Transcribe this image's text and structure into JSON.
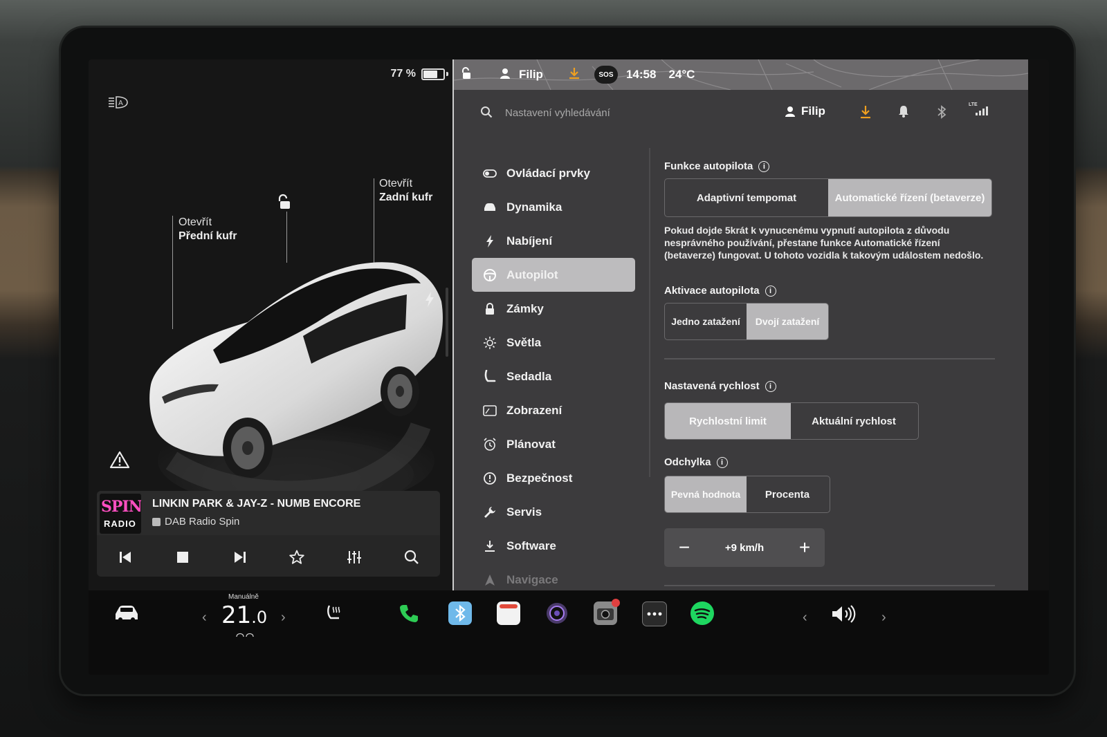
{
  "battery": {
    "percent_label": "77 %",
    "level": 0.77
  },
  "car": {
    "front_trunk": {
      "line1": "Otevřít",
      "line2": "Přední kufr"
    },
    "rear_trunk": {
      "line1": "Otevřít",
      "line2": "Zadní kufr"
    }
  },
  "media": {
    "album_line1": "SPIN",
    "album_line2": "RADIO",
    "song": "LINKIN PARK & JAY-Z - NUMB ENCORE",
    "station": "DAB Radio Spin"
  },
  "statusbar": {
    "user": "Filip",
    "sos": "SOS",
    "time": "14:58",
    "temperature": "24°C"
  },
  "search": {
    "placeholder": "Nastavení vyhledávání"
  },
  "header": {
    "user": "Filip",
    "lte": "LTE"
  },
  "menu": [
    {
      "label": "Ovládací prvky",
      "icon": "toggle-icon"
    },
    {
      "label": "Dynamika",
      "icon": "car-icon"
    },
    {
      "label": "Nabíjení",
      "icon": "bolt-icon"
    },
    {
      "label": "Autopilot",
      "icon": "steering-wheel-icon",
      "active": true
    },
    {
      "label": "Zámky",
      "icon": "lock-icon"
    },
    {
      "label": "Světla",
      "icon": "sun-icon"
    },
    {
      "label": "Sedadla",
      "icon": "seat-icon"
    },
    {
      "label": "Zobrazení",
      "icon": "display-icon"
    },
    {
      "label": "Plánovat",
      "icon": "alarm-clock-icon"
    },
    {
      "label": "Bezpečnost",
      "icon": "alert-circle-icon"
    },
    {
      "label": "Servis",
      "icon": "wrench-icon"
    },
    {
      "label": "Software",
      "icon": "download-icon"
    },
    {
      "label": "Navigace",
      "icon": "navigation-icon"
    }
  ],
  "autopilot": {
    "features": {
      "title": "Funkce autopilota",
      "options": [
        "Adaptivní tempomat",
        "Automatické řízení (betaverze)"
      ],
      "selected": 1,
      "description": "Pokud dojde 5krát k vynucenému vypnutí autopilota z důvodu nesprávného používání, přestane funkce Automatické řízení (betaverze) fungovat. U tohoto vozidla k takovým událostem nedošlo."
    },
    "activation": {
      "title": "Aktivace autopilota",
      "options": [
        "Jedno zatažení",
        "Dvojí zatažení"
      ],
      "selected": 1
    },
    "speed": {
      "title": "Nastavená rychlost",
      "options": [
        "Rychlostní limit",
        "Aktuální rychlost"
      ],
      "selected": 0
    },
    "offset": {
      "title": "Odchylka",
      "options": [
        "Pevná hodnota",
        "Procenta"
      ],
      "selected": 0,
      "value": "+9 km/h",
      "minus": "−",
      "plus": "+"
    }
  },
  "dock": {
    "climate_mode": "Manuálně",
    "temp_whole": "21",
    "temp_decimal": ".0",
    "left_chevron": "‹",
    "right_chevron": "›"
  },
  "colors": {
    "accent_orange": "#f0a020",
    "spotify_green": "#1ed760",
    "bluetooth_blue": "#6fb9ea",
    "phone_green": "#2ecc55"
  }
}
